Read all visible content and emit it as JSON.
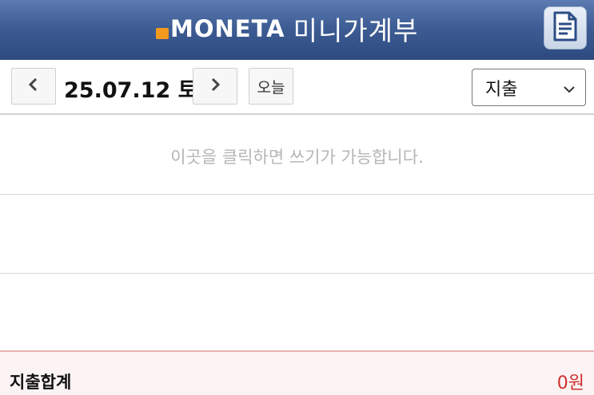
{
  "header": {
    "brand_name": "MONETA",
    "title": "미니가계부",
    "memo_icon": "document-icon",
    "accent_color": "#f39a1e"
  },
  "toolbar": {
    "prev_icon": "chevron-left-icon",
    "date": "25.07.12 토",
    "next_icon": "chevron-right-icon",
    "today_label": "오늘",
    "type_select": {
      "selected": "지출",
      "icon": "chevron-down-icon"
    }
  },
  "entries": {
    "hint": "이곳을 클릭하면 쓰기가 가능합니다."
  },
  "footer": {
    "total_label": "지출합계",
    "total_value": "0원",
    "total_color": "#d32f2f"
  }
}
